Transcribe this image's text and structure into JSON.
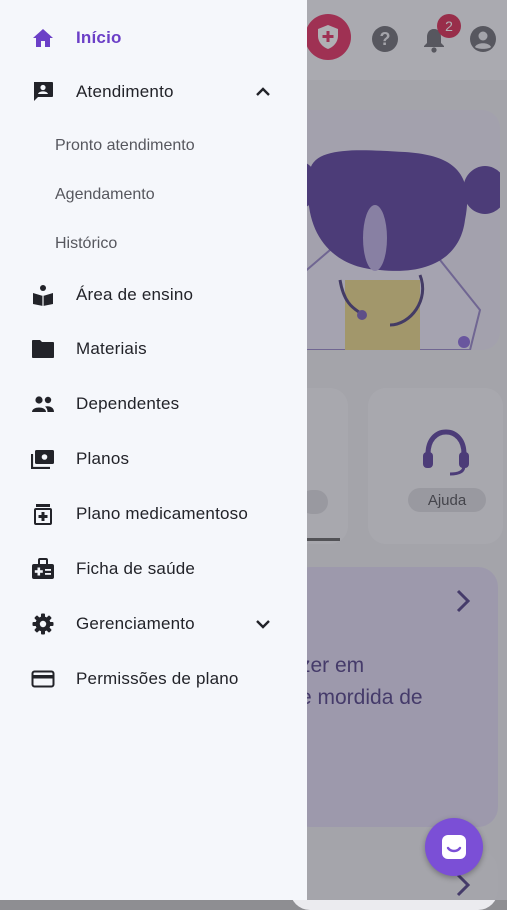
{
  "background": {
    "notification_count": "2",
    "help_glyph": "?",
    "ajuda_label": "Ajuda",
    "promo_text": "zer em\ne mordida de",
    "icons": [
      "shield-plus-icon",
      "help-icon",
      "bell-icon",
      "account-icon",
      "headset-icon",
      "chevron-right-icon",
      "chat-icon"
    ]
  },
  "menu": {
    "inicio": {
      "label": "Início",
      "icon": "home-icon"
    },
    "atendimento": {
      "label": "Atendimento",
      "icon": "chat-person-icon",
      "expanded": true,
      "sub": [
        "Pronto atendimento",
        "Agendamento",
        "Histórico"
      ]
    },
    "area_ensino": {
      "label": "Área de ensino",
      "icon": "book-reader-icon"
    },
    "materiais": {
      "label": "Materiais",
      "icon": "folder-icon"
    },
    "dependentes": {
      "label": "Dependentes",
      "icon": "people-icon"
    },
    "planos": {
      "label": "Planos",
      "icon": "plans-icon"
    },
    "plano_med": {
      "label": "Plano medicamentoso",
      "icon": "medication-icon"
    },
    "ficha": {
      "label": "Ficha de saúde",
      "icon": "medical-kit-icon"
    },
    "gerenciamento": {
      "label": "Gerenciamento",
      "icon": "gear-icon",
      "expanded": false
    },
    "permissoes": {
      "label": "Permissões de plano",
      "icon": "card-icon"
    }
  },
  "colors": {
    "accent": "#6b3fc7",
    "text": "#222329",
    "drawer_bg": "#f5f7fb",
    "badge": "#d3133f"
  }
}
